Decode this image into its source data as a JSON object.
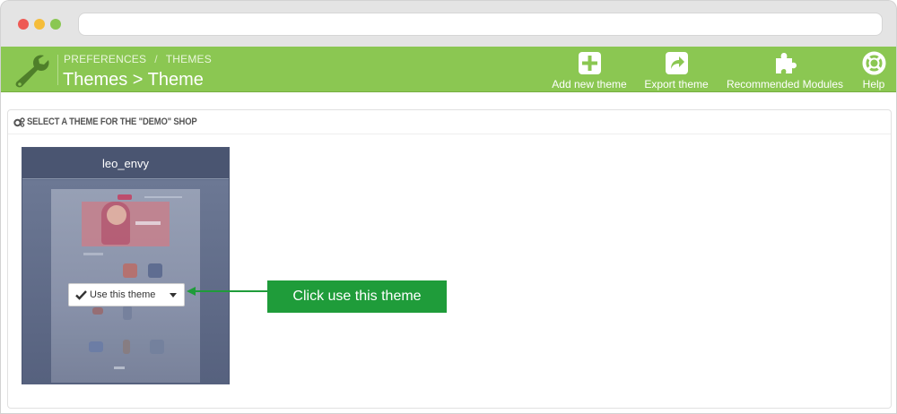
{
  "header": {
    "breadcrumb": [
      "PREFERENCES",
      "THEMES"
    ],
    "breadcrumb_separator": "/",
    "title": "Themes > Theme",
    "toolbar": [
      {
        "label": "Add new theme",
        "icon": "plus-square-icon"
      },
      {
        "label": "Export theme",
        "icon": "share-icon"
      },
      {
        "label": "Recommended Modules",
        "icon": "puzzle-icon"
      },
      {
        "label": "Help",
        "icon": "lifebuoy-icon"
      }
    ]
  },
  "panel": {
    "title": "SELECT A THEME FOR THE \"DEMO\" SHOP",
    "icon": "cogs-icon"
  },
  "theme_card": {
    "name": "leo_envy",
    "use_button_label": "Use this theme"
  },
  "annotation": {
    "text": "Click use this theme"
  },
  "colors": {
    "header_green": "#8bc752",
    "card_background": "#5e6c89",
    "callout_green": "#1f9c3a"
  }
}
